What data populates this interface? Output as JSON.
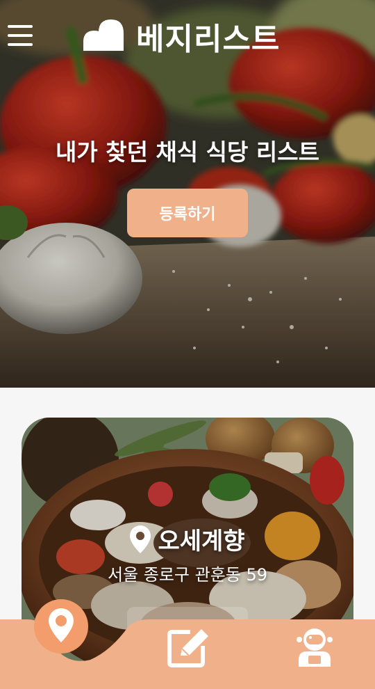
{
  "header": {
    "brand_name": "베지리스트",
    "menu_icon": "hamburger-menu-icon",
    "logo_icon": "logo-icon"
  },
  "hero": {
    "headline": "내가 찾던 채식 식당 리스트",
    "register_label": "등록하기"
  },
  "card": {
    "name": "오세계향",
    "address": "서울 종로구 관훈동 59",
    "pin_icon": "map-pin-icon"
  },
  "bottom_nav": {
    "items": [
      {
        "icon": "map-pin-icon",
        "active": true
      },
      {
        "icon": "edit-icon",
        "active": false
      },
      {
        "icon": "user-astronaut-icon",
        "active": false
      }
    ],
    "accent": "#f0b089",
    "active_circle": "#f29d6b"
  },
  "colors": {
    "accent": "#f0b089",
    "background": "#f6f6f6",
    "text_on_image": "#ffffff"
  }
}
